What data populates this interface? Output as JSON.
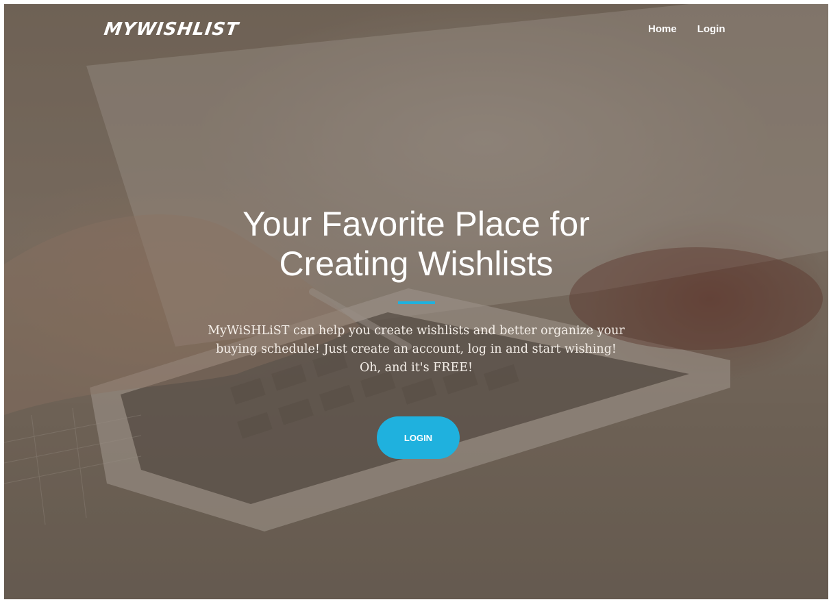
{
  "header": {
    "brand": "MYWISHLIST",
    "nav": [
      {
        "label": "Home"
      },
      {
        "label": "Login"
      }
    ]
  },
  "hero": {
    "title": "Your Favorite Place for Creating Wishlists",
    "description": "MyWiSHLiST can help you create wishlists and better organize your buying schedule! Just create an account, log in and start wishing! Oh, and it's FREE!",
    "button_label": "LOGIN"
  },
  "colors": {
    "accent": "#1fb1de",
    "text": "#ffffff"
  }
}
